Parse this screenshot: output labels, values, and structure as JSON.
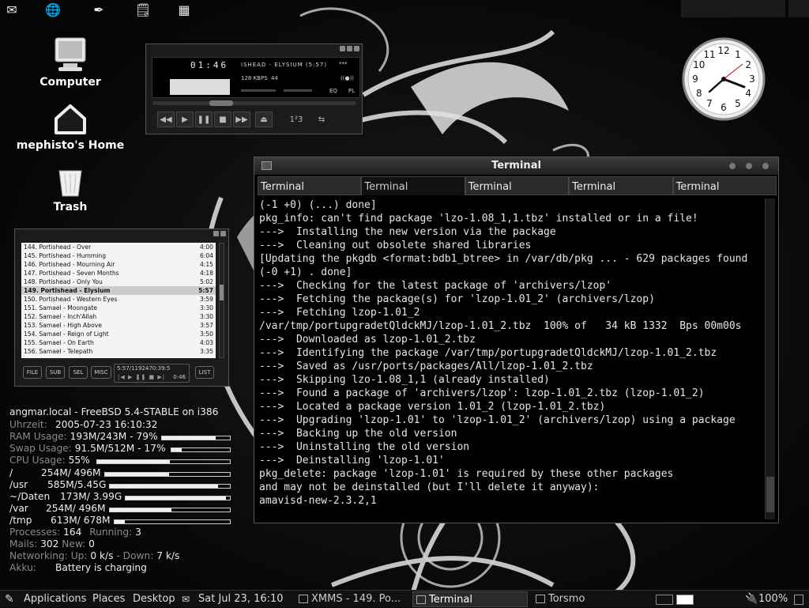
{
  "desktop": {
    "icons": [
      {
        "label": "Computer",
        "icon": "computer-icon"
      },
      {
        "label": "mephisto's Home",
        "icon": "home-icon"
      },
      {
        "label": "Trash",
        "icon": "trash-icon"
      }
    ]
  },
  "clock": {
    "numerals": [
      "12",
      "1",
      "2",
      "3",
      "4",
      "5",
      "6",
      "7",
      "8",
      "9",
      "10",
      "11"
    ]
  },
  "xmms": {
    "time": "01:46",
    "song": "ISHEAD - ELYSIUM (5:57)",
    "stars": "***",
    "kbps": "128 KBPS",
    "khz": "44",
    "stereo": "((●))",
    "eq_label": "EQ",
    "pl_label": "PL",
    "shuffle_label": "1²3",
    "seek_fraction": 0.3
  },
  "playlist": {
    "rows": [
      {
        "title": "144. Portishead - Over",
        "duration": "4:00"
      },
      {
        "title": "145. Portishead - Humming",
        "duration": "6:04"
      },
      {
        "title": "146. Portishead - Mourning Air",
        "duration": "4:15"
      },
      {
        "title": "147. Portishead - Seven Months",
        "duration": "4:18"
      },
      {
        "title": "148. Portishead - Only You",
        "duration": "5:02"
      },
      {
        "title": "149. Portishead - Elysium",
        "duration": "5:57"
      },
      {
        "title": "150. Portishead - Western Eyes",
        "duration": "3:59"
      },
      {
        "title": "151. Samael - Moongate",
        "duration": "3:30"
      },
      {
        "title": "152. Samael - Inch'Allah",
        "duration": "3:30"
      },
      {
        "title": "153. Samael - High Above",
        "duration": "3:57"
      },
      {
        "title": "154. Samael - Reign of Light",
        "duration": "3:50"
      },
      {
        "title": "155. Samael - On Earth",
        "duration": "4:03"
      },
      {
        "title": "156. Samael - Telepath",
        "duration": "3:35"
      }
    ],
    "selected_index": 5,
    "buttons": [
      "FILE",
      "SUB",
      "SEL",
      "MISC",
      "LIST"
    ],
    "time_total": "5:57/1192470:39:5",
    "time_elapsed": "0:46",
    "mini_controls": "|◀ ▶ ❚❚ ■ ▶|"
  },
  "conky": {
    "header": "angmar.local - FreeBSD 5.4-STABLE on i386",
    "uhrzeit_label": "Uhrzeit:",
    "uhrzeit": "2005-07-23 16:10:32",
    "ram_label": "RAM Usage:",
    "ram": "193M/243M - 79%",
    "ram_pct": 79,
    "swap_label": "Swap Usage:",
    "swap": "91.5M/512M - 17%",
    "swap_pct": 17,
    "cpu_label": "CPU Usage:",
    "cpu": "55%",
    "cpu_pct": 55,
    "fs": [
      {
        "mount": "/",
        "usage": "254M/ 496M",
        "pct": 51
      },
      {
        "mount": "/usr",
        "usage": "585M/5.45G",
        "pct": 90
      },
      {
        "mount": "~/Daten",
        "usage": "173M/ 3.99G",
        "pct": 96
      },
      {
        "mount": "/var",
        "usage": "254M/ 496M",
        "pct": 51
      },
      {
        "mount": "/tmp",
        "usage": "613M/ 678M",
        "pct": 9
      }
    ],
    "processes_label": "Processes:",
    "processes": "164",
    "running_label": "Running:",
    "running": "3",
    "mails_label": "Mails:",
    "mails": "302",
    "new_label": "New:",
    "new": "0",
    "net_label": "Networking: Up:",
    "net_up": "0 k/s",
    "down_label": "- Down:",
    "net_down": "7 k/s",
    "akku_label": "Akku:",
    "akku": "Battery is charging"
  },
  "terminal": {
    "title": "Terminal",
    "tabs": [
      "Terminal",
      "Terminal",
      "Terminal",
      "Terminal",
      "Terminal"
    ],
    "active_tab": 1,
    "lines": [
      "(-1 +0) (...) done]",
      "pkg_info: can't find package 'lzo-1.08_1,1.tbz' installed or in a file!",
      "--->  Installing the new version via the package",
      "--->  Cleaning out obsolete shared libraries",
      "[Updating the pkgdb <format:bdb1_btree> in /var/db/pkg ... - 629 packages found",
      "(-0 +1) . done]",
      "--->  Checking for the latest package of 'archivers/lzop'",
      "--->  Fetching the package(s) for 'lzop-1.01_2' (archivers/lzop)",
      "--->  Fetching lzop-1.01_2",
      "/var/tmp/portupgradetQldckMJ/lzop-1.01_2.tbz  100% of   34 kB 1332  Bps 00m00s",
      "--->  Downloaded as lzop-1.01_2.tbz",
      "--->  Identifying the package /var/tmp/portupgradetQldckMJ/lzop-1.01_2.tbz",
      "--->  Saved as /usr/ports/packages/All/lzop-1.01_2.tbz",
      "--->  Skipping lzo-1.08_1,1 (already installed)",
      "--->  Found a package of 'archivers/lzop': lzop-1.01_2.tbz (lzop-1.01_2)",
      "--->  Located a package version 1.01_2 (lzop-1.01_2.tbz)",
      "--->  Upgrading 'lzop-1.01' to 'lzop-1.01_2' (archivers/lzop) using a package",
      "--->  Backing up the old version",
      "--->  Uninstalling the old version",
      "--->  Deinstalling 'lzop-1.01'",
      "pkg_delete: package 'lzop-1.01' is required by these other packages",
      "and may not be deinstalled (but I'll delete it anyway):",
      "amavisd-new-2.3.2,1"
    ]
  },
  "taskbar": {
    "applications": "Applications",
    "places": "Places",
    "desktop": "Desktop",
    "datetime": "Sat Jul 23, 16:10",
    "tasks": [
      {
        "label": "XMMS - 149. Po...",
        "active": false
      },
      {
        "label": "Terminal",
        "active": true
      },
      {
        "label": "Torsmo",
        "active": false
      }
    ],
    "battery": "100%"
  },
  "colors": {
    "background": "#0b0b0b",
    "text": "#e6e6e6",
    "muted": "#8a8a8a"
  }
}
